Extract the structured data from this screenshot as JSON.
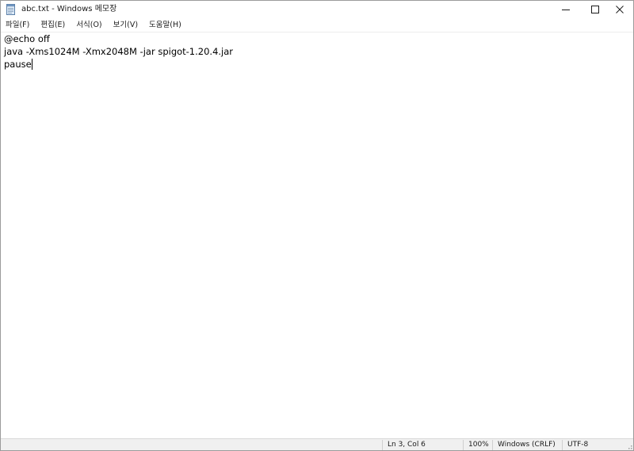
{
  "window": {
    "title": "abc.txt - Windows 메모장"
  },
  "menu": {
    "items": [
      {
        "label": "파일(F)"
      },
      {
        "label": "편집(E)"
      },
      {
        "label": "서식(O)"
      },
      {
        "label": "보기(V)"
      },
      {
        "label": "도움말(H)"
      }
    ]
  },
  "editor": {
    "lines": [
      "@echo off",
      "java -Xms1024M -Xmx2048M -jar spigot-1.20.4.jar",
      "pause"
    ]
  },
  "status": {
    "position": "Ln 3, Col 6",
    "zoom": "100%",
    "line_ending": "Windows (CRLF)",
    "encoding": "UTF-8"
  },
  "icons": {
    "app": "notepad-icon",
    "minimize": "minimize-icon",
    "maximize": "maximize-icon",
    "close": "close-icon",
    "grip": "resize-grip-icon"
  },
  "colors": {
    "statusbar_bg": "#f0f0f0",
    "window_bg": "#ffffff",
    "text": "#000000"
  }
}
